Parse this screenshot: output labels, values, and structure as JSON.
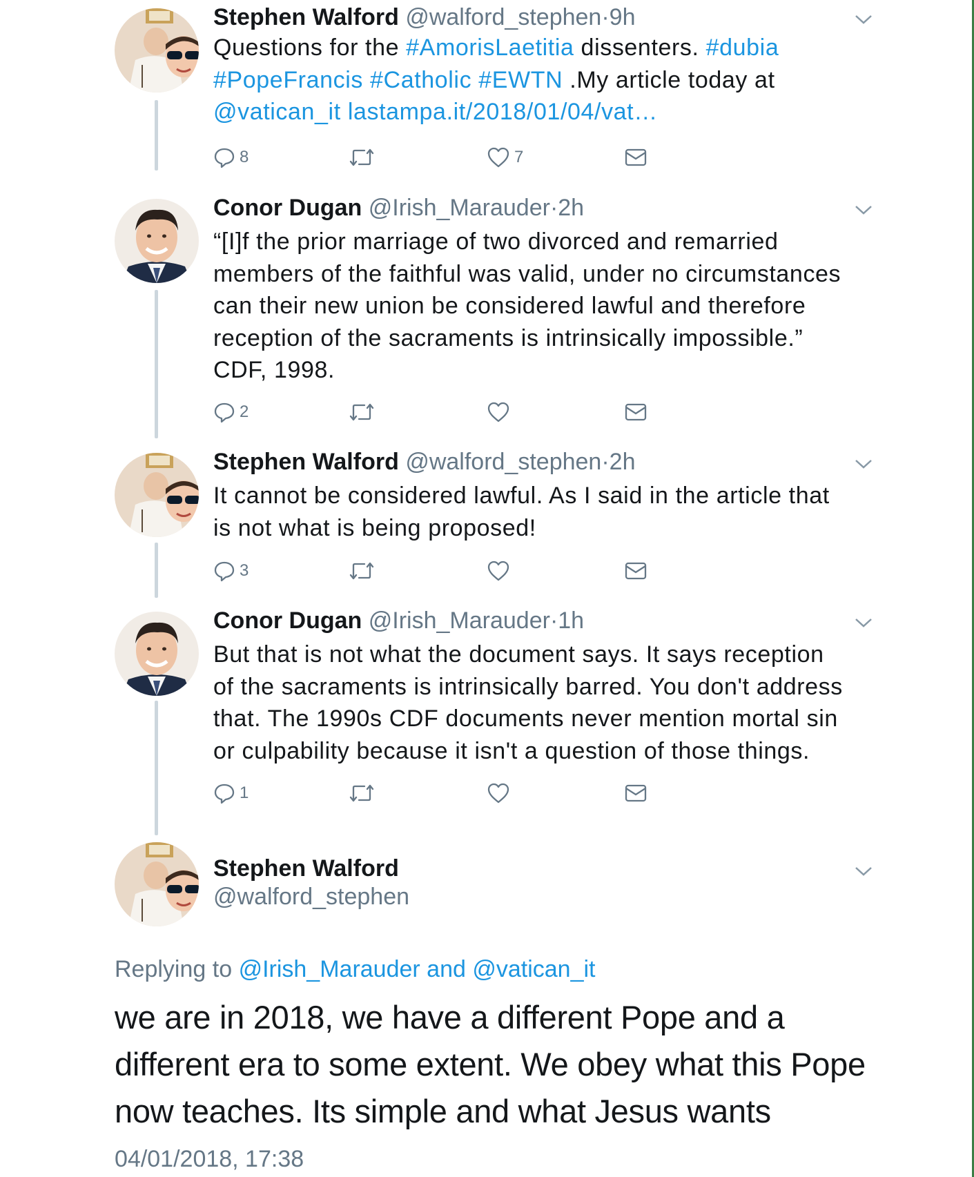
{
  "tweets": [
    {
      "name": "Stephen Walford",
      "handle": "@walford_stephen",
      "separator": "·",
      "time": "9h",
      "text_lines": [
        [
          {
            "t": "Questions for the ",
            "link": false
          },
          {
            "t": "#AmorisLaetitia",
            "link": true
          },
          {
            "t": " dissenters. ",
            "link": false
          },
          {
            "t": "#dubia",
            "link": true
          }
        ],
        [
          {
            "t": "#PopeFrancis",
            "link": true
          },
          {
            "t": " ",
            "link": false
          },
          {
            "t": "#Catholic",
            "link": true
          },
          {
            "t": " ",
            "link": false
          },
          {
            "t": "#EWTN",
            "link": true
          },
          {
            "t": " .My article today at",
            "link": false
          }
        ],
        [
          {
            "t": "@vatican_it",
            "link": true
          },
          {
            "t": " ",
            "link": false
          },
          {
            "t": "lastampa.it/2018/01/04/vat…",
            "link": true
          }
        ]
      ],
      "reply_count": "8",
      "retweet_count": "",
      "like_count": "7"
    },
    {
      "name": "Conor Dugan",
      "handle": "@Irish_Marauder",
      "separator": "·",
      "time": "2h",
      "text_lines": [
        [
          {
            "t": "“[I]f the prior marriage of two divorced and remarried",
            "link": false
          }
        ],
        [
          {
            "t": "members of the faithful was valid, under no circumstances",
            "link": false
          }
        ],
        [
          {
            "t": "can their new union be considered lawful and therefore",
            "link": false
          }
        ],
        [
          {
            "t": "reception of the sacraments is intrinsically impossible.”",
            "link": false
          }
        ],
        [
          {
            "t": "CDF, 1998.",
            "link": false
          }
        ]
      ],
      "reply_count": "2",
      "retweet_count": "",
      "like_count": ""
    },
    {
      "name": "Stephen Walford",
      "handle": "@walford_stephen",
      "separator": "·",
      "time": "2h",
      "text_lines": [
        [
          {
            "t": "It cannot be considered lawful. As I said in the article that",
            "link": false
          }
        ],
        [
          {
            "t": "is not what is being proposed!",
            "link": false
          }
        ]
      ],
      "reply_count": "3",
      "retweet_count": "",
      "like_count": ""
    },
    {
      "name": "Conor Dugan",
      "handle": "@Irish_Marauder",
      "separator": "·",
      "time": "1h",
      "text_lines": [
        [
          {
            "t": "But that is not what the document says.  It says reception",
            "link": false
          }
        ],
        [
          {
            "t": "of the sacraments is intrinsically barred.  You don't address",
            "link": false
          }
        ],
        [
          {
            "t": "that.  The 1990s CDF documents never mention mortal sin",
            "link": false
          }
        ],
        [
          {
            "t": "or culpability because it isn't a question of those things.",
            "link": false
          }
        ]
      ],
      "reply_count": "1",
      "retweet_count": "",
      "like_count": ""
    }
  ],
  "main_tweet": {
    "name": "Stephen Walford",
    "handle": "@walford_stephen",
    "replying_prefix": "Replying to",
    "replying_to": "@Irish_Marauder and @vatican_it",
    "text_lines": [
      "we are in 2018, we have a different Pope and a",
      "different era to some extent. We obey what this Pope",
      "now teaches. Its simple and what Jesus wants"
    ],
    "timestamp": "04/01/2018, 17:38"
  },
  "icons": {
    "reply": "reply-icon",
    "retweet": "retweet-icon",
    "like": "heart-icon",
    "dm": "envelope-icon",
    "more": "chevron-down-icon"
  },
  "colors": {
    "link": "#1b95e0",
    "secondary_text": "#657786",
    "thread_line": "#ccd6dd"
  }
}
